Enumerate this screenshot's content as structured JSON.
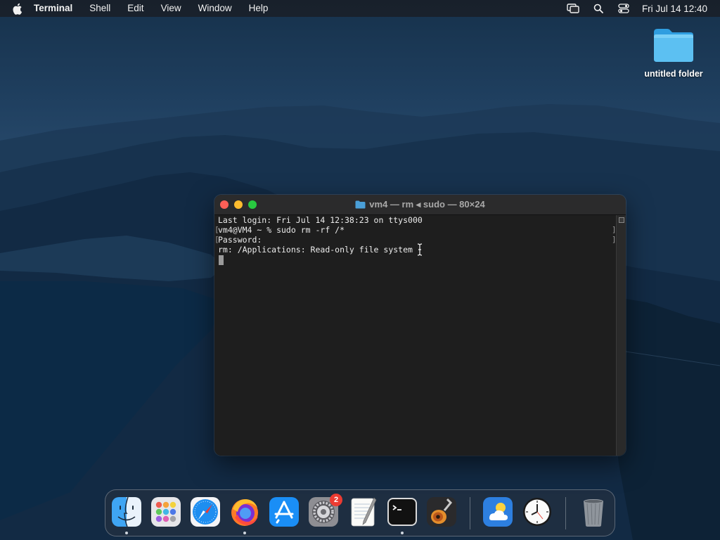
{
  "menubar": {
    "app_name": "Terminal",
    "menus": [
      "Shell",
      "Edit",
      "View",
      "Window",
      "Help"
    ],
    "clock": "Fri Jul 14  12:40",
    "status_icons": [
      "screen-mirroring-icon",
      "search-icon",
      "control-center-icon"
    ]
  },
  "desktop": {
    "folder_label": "untitled folder"
  },
  "terminal": {
    "title": "vm4 — rm ◂ sudo — 80×24",
    "lines": [
      "Last login: Fri Jul 14 12:38:23 on ttys000",
      "vm4@VM4 ~ % sudo rm -rf /*",
      "Password:",
      "rm: /Applications: Read-only file system"
    ],
    "colors": {
      "close": "#fe5f57",
      "minimize": "#febc2e",
      "zoom": "#28c840"
    }
  },
  "dock": {
    "apps": [
      "Finder",
      "Launchpad",
      "Safari",
      "Firefox",
      "App Store",
      "System Settings",
      "TextEdit",
      "Terminal",
      "GarageBand",
      "Weather",
      "Clock",
      "Trash"
    ],
    "badge_count": "2"
  }
}
